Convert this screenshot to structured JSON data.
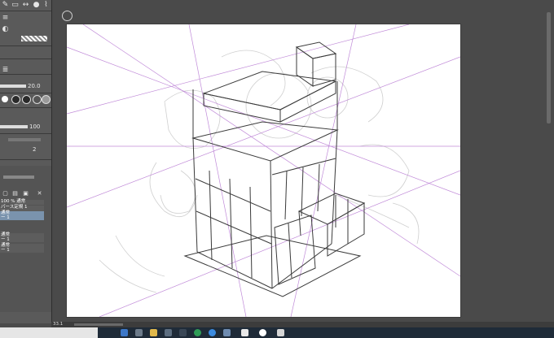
{
  "left_panel": {
    "brush_size": "20.0",
    "opacity": "100",
    "stabilization": "2",
    "layer_panel": {
      "blend_label": "100 % 通常",
      "layers": [
        {
          "name": "パース定規 1",
          "selected": false
        },
        {
          "name": "通常",
          "detail": "ー 1",
          "selected": true
        },
        {
          "name": "通常",
          "detail": "ー 1",
          "selected": false
        },
        {
          "name": "通常",
          "detail": "ー 1",
          "selected": false
        }
      ]
    }
  },
  "canvas": {
    "background": "#ffffff",
    "guide_color": "#b57ad0",
    "sketch_color": "#3a3a3a",
    "underlay_color": "#c8c8c8"
  },
  "bottom_bar": {
    "zoom": "33.1"
  },
  "taskbar_icons": [
    "search-icon",
    "task-view-icon",
    "folder-icon",
    "chrome-icon",
    "app-icon",
    "app-icon-2",
    "clip-studio-icon",
    "chat-icon",
    "window-icon"
  ]
}
